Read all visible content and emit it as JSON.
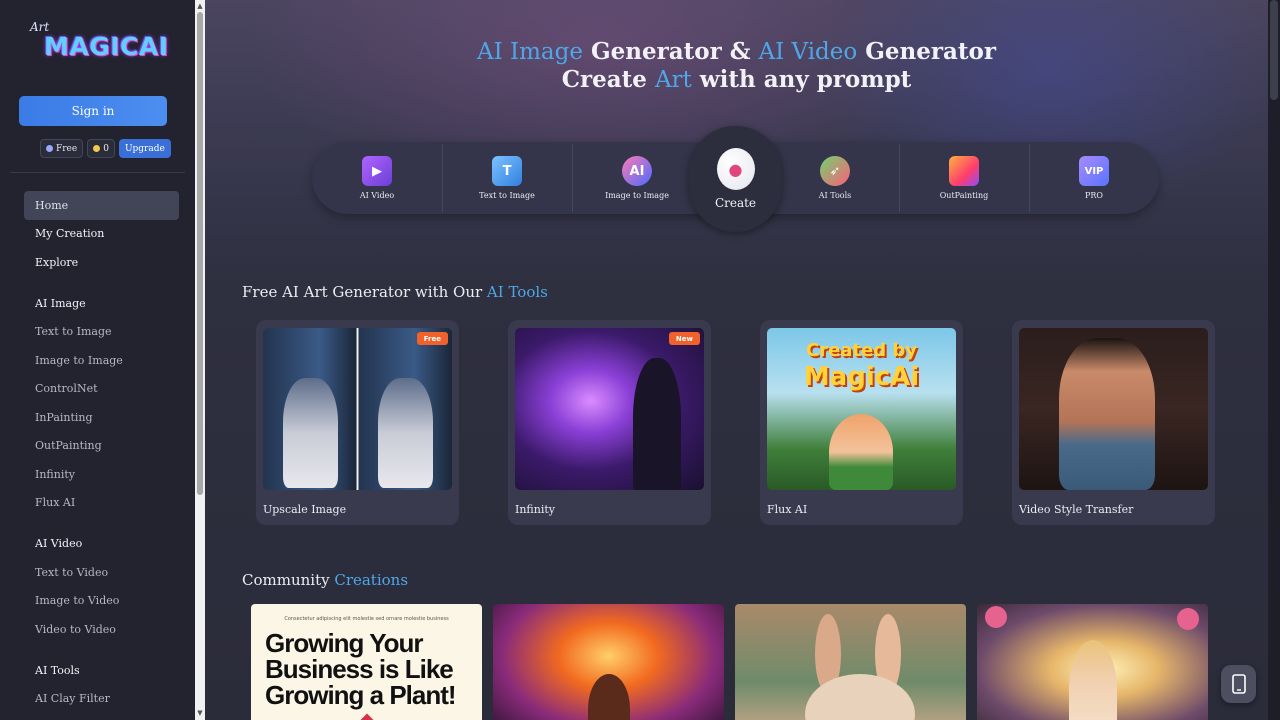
{
  "sidebar": {
    "logo": {
      "text": "MAGICAI",
      "scrawl": "Art"
    },
    "signin_label": "Sign in",
    "badges": {
      "free": "Free",
      "coins": "0",
      "upgrade": "Upgrade"
    },
    "nav_top": [
      "Home",
      "My Creation",
      "Explore"
    ],
    "sections": [
      {
        "title": "AI Image",
        "items": [
          "Text to Image",
          "Image to Image",
          "ControlNet",
          "InPainting",
          "OutPainting",
          "Infinity",
          "Flux AI"
        ]
      },
      {
        "title": "AI Video",
        "items": [
          "Text to Video",
          "Image to Video",
          "Video to Video"
        ]
      },
      {
        "title": "AI Tools",
        "items": [
          "AI Clay Filter"
        ]
      }
    ]
  },
  "hero": {
    "line1_a": "AI Image",
    "line1_b": " Generator & ",
    "line1_c": "AI Video",
    "line1_d": " Generator",
    "line2_a": "Create ",
    "line2_b": "Art",
    "line2_c": " with any prompt"
  },
  "tools": {
    "items": [
      "AI Video",
      "Text to Image",
      "Image to Image",
      "AI Tools",
      "OutPainting",
      "PRO"
    ],
    "create_label": "Create",
    "icon_names": [
      "video-icon",
      "text-to-image-icon",
      "image-to-image-icon",
      "palette-icon",
      "rocket-icon",
      "outpainting-icon",
      "vip-icon"
    ]
  },
  "ai_tools_section": {
    "title_a": "Free AI Art Generator with Our ",
    "title_b": "AI Tools",
    "cards": [
      {
        "caption": "Upscale Image",
        "tag": "Free"
      },
      {
        "caption": "Infinity",
        "tag": "New"
      },
      {
        "caption": "Flux AI",
        "tag": "",
        "art_text_1": "Created by",
        "art_text_2": "MagicAi"
      },
      {
        "caption": "Video Style Transfer",
        "tag": ""
      }
    ]
  },
  "community": {
    "title_a": "Community ",
    "title_b": "Creations",
    "poster_small": "Consectetur adipiscing elit molestie sed ornare molestie business",
    "poster_big": "Growing Your Business is Like Growing a Plant!"
  },
  "colors": {
    "accent": "#4fa7e8",
    "signin": "#3b7be6",
    "free_tag": "#f0612c",
    "new_tag": "#f0612c"
  }
}
